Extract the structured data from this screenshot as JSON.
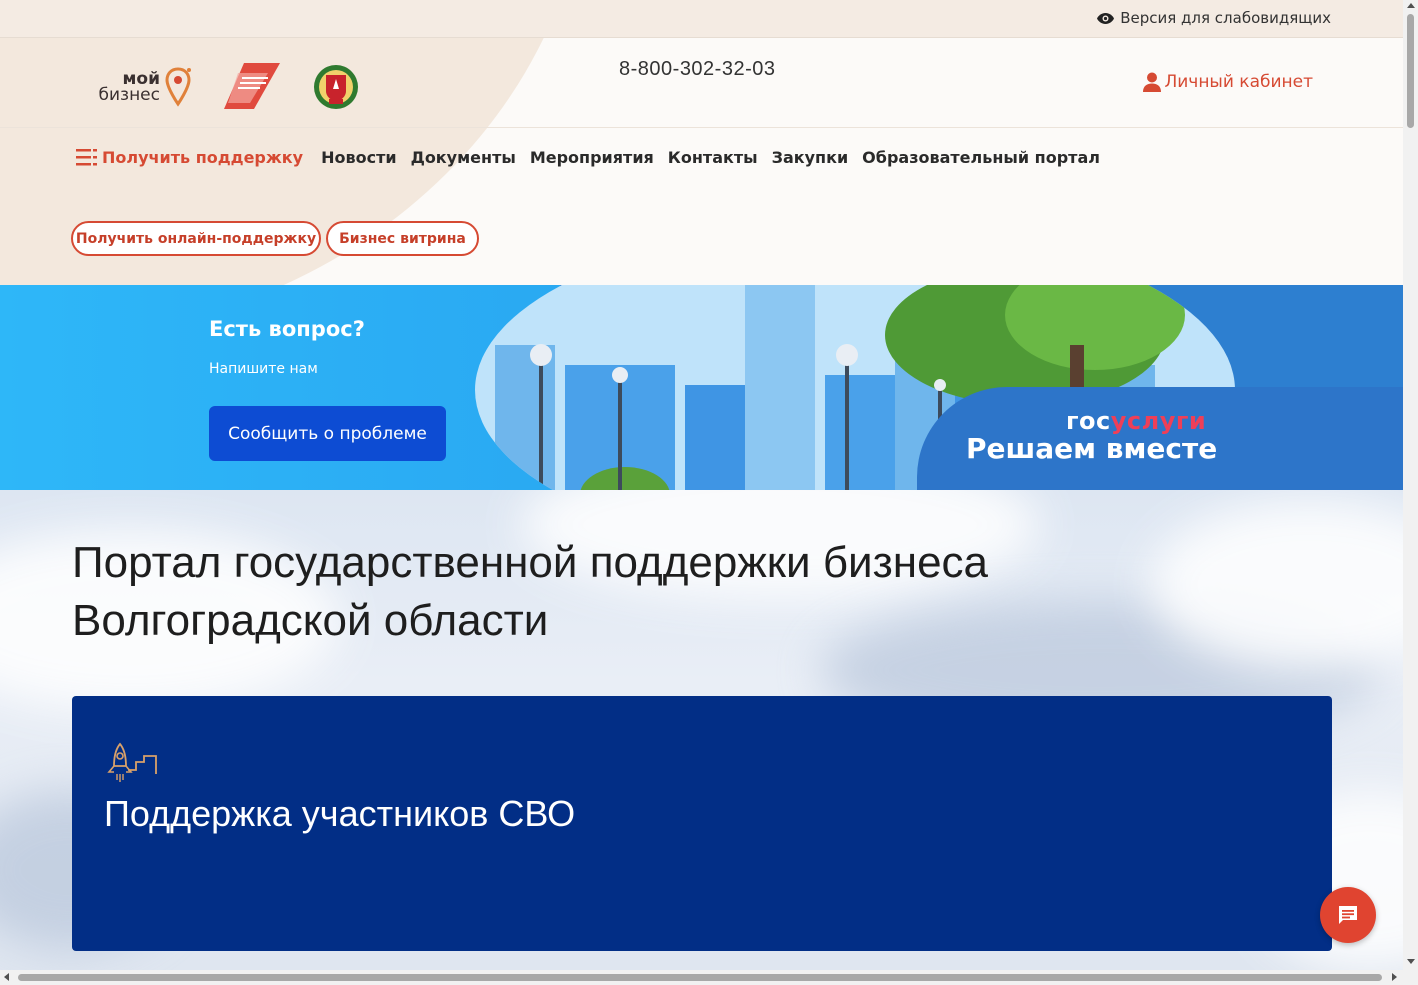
{
  "topbar": {
    "a11y_label": "Версия для слабовидящих",
    "a11y_icon": "eye-icon"
  },
  "header": {
    "logo_moy_line1": "мой",
    "logo_moy_line2": "бизнес",
    "phone": "8-800-302-32-03",
    "cabinet_label": "Личный кабинет",
    "cabinet_icon": "user-icon"
  },
  "nav": {
    "menu_label": "Получить поддержку",
    "menu_icon": "hamburger-icon",
    "items": [
      {
        "label": "Новости"
      },
      {
        "label": "Документы"
      },
      {
        "label": "Мероприятия"
      },
      {
        "label": "Контакты"
      },
      {
        "label": "Закупки"
      },
      {
        "label": "Образовательный портал"
      }
    ]
  },
  "actions": {
    "online_support": "Получить онлайн-поддержку",
    "showcase": "Бизнес витрина"
  },
  "banner": {
    "title": "Есть вопрос?",
    "subtitle": "Напишите нам",
    "button": "Сообщить о проблеме",
    "gos_part1": "гос",
    "gos_part2": "услуги",
    "slogan": "Решаем вместе"
  },
  "main": {
    "title_line1": "Портал государственной поддержки бизнеса",
    "title_line2": "Волгоградской области",
    "card_title": "Поддержка участников СВО",
    "card_icon": "rocket-icon"
  },
  "chat": {
    "icon": "chat-icon"
  },
  "colors": {
    "accent": "#d64a33",
    "card_bg": "#022e86",
    "banner_button": "#0d4cd3",
    "banner_bg": "#2d7fd0"
  }
}
